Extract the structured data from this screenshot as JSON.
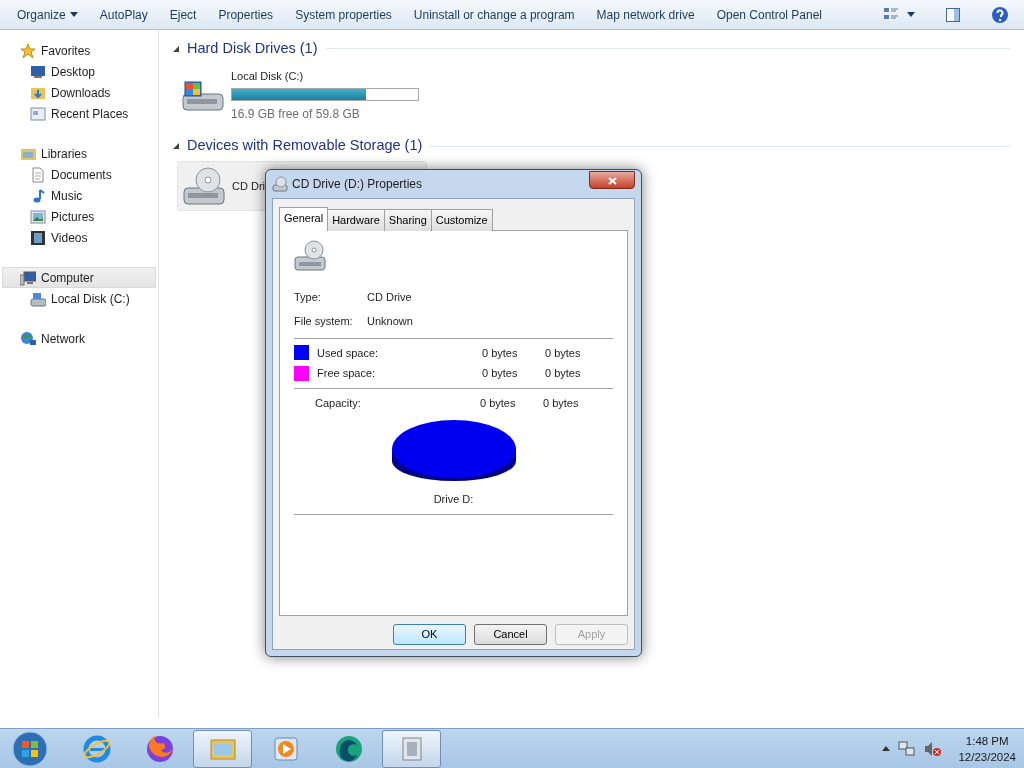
{
  "toolbar": {
    "items": [
      {
        "label": "Organize",
        "dropdown": true
      },
      {
        "label": "AutoPlay",
        "dropdown": false
      },
      {
        "label": "Eject",
        "dropdown": false
      },
      {
        "label": "Properties",
        "dropdown": false
      },
      {
        "label": "System properties",
        "dropdown": false
      },
      {
        "label": "Uninstall or change a program",
        "dropdown": false
      },
      {
        "label": "Map network drive",
        "dropdown": false
      },
      {
        "label": "Open Control Panel",
        "dropdown": false
      }
    ]
  },
  "sidebar": {
    "groups": [
      {
        "label": "Favorites",
        "kind": "star",
        "selected": false,
        "children": [
          {
            "label": "Desktop",
            "kind": "desktop",
            "selected": false
          },
          {
            "label": "Downloads",
            "kind": "downloads",
            "selected": false
          },
          {
            "label": "Recent Places",
            "kind": "recent",
            "selected": false
          }
        ]
      },
      {
        "label": "Libraries",
        "kind": "library",
        "selected": false,
        "children": [
          {
            "label": "Documents",
            "kind": "document",
            "selected": false
          },
          {
            "label": "Music",
            "kind": "music",
            "selected": false
          },
          {
            "label": "Pictures",
            "kind": "pictures",
            "selected": false
          },
          {
            "label": "Videos",
            "kind": "videos",
            "selected": false
          }
        ]
      },
      {
        "label": "Computer",
        "kind": "computer",
        "selected": true,
        "children": [
          {
            "label": "Local Disk (C:)",
            "kind": "disk",
            "selected": false
          }
        ]
      },
      {
        "label": "Network",
        "kind": "network",
        "selected": false
      }
    ]
  },
  "sections": [
    {
      "title": "Hard Disk Drives (1)",
      "items": [
        {
          "kind": "disk",
          "name": "Local Disk (C:)",
          "level": 0.72,
          "detail": "16.9 GB free of 59.8 GB",
          "selected": false
        }
      ]
    },
    {
      "title": "Devices with Removable Storage (1)",
      "items": [
        {
          "kind": "cd",
          "name": "CD Dri",
          "selected": true
        }
      ]
    }
  ],
  "dialog": {
    "title": "CD Drive (D:) Properties",
    "tabs": [
      {
        "label": "General",
        "selected": true
      },
      {
        "label": "Hardware",
        "selected": false
      },
      {
        "label": "Sharing",
        "selected": false
      },
      {
        "label": "Customize",
        "selected": false
      }
    ],
    "properties": [
      {
        "label": "Type:",
        "value": "CD Drive"
      },
      {
        "label": "File system:",
        "value": "Unknown"
      }
    ],
    "space": [
      {
        "label": "Used space:",
        "color": "#0000ff",
        "bytes": "0 bytes",
        "size": "0 bytes"
      },
      {
        "label": "Free space:",
        "color": "#ff00ff",
        "bytes": "0 bytes",
        "size": "0 bytes"
      }
    ],
    "capacity": {
      "label": "Capacity:",
      "bytes": "0 bytes",
      "size": "0 bytes"
    },
    "drive_label": "Drive D:",
    "buttons": [
      {
        "label": "OK",
        "default": true,
        "disabled": false
      },
      {
        "label": "Cancel",
        "default": false,
        "disabled": false
      },
      {
        "label": "Apply",
        "default": false,
        "disabled": true
      }
    ]
  },
  "taskbar": {
    "apps": [
      {
        "kind": "ie",
        "selected": false
      },
      {
        "kind": "firefox",
        "selected": false
      },
      {
        "kind": "folder",
        "selected": true
      },
      {
        "kind": "media",
        "selected": false
      },
      {
        "kind": "orb",
        "selected": false
      },
      {
        "kind": "window",
        "selected": true
      }
    ],
    "clock": {
      "time": "1:48 PM",
      "date": "12/23/2024"
    }
  }
}
